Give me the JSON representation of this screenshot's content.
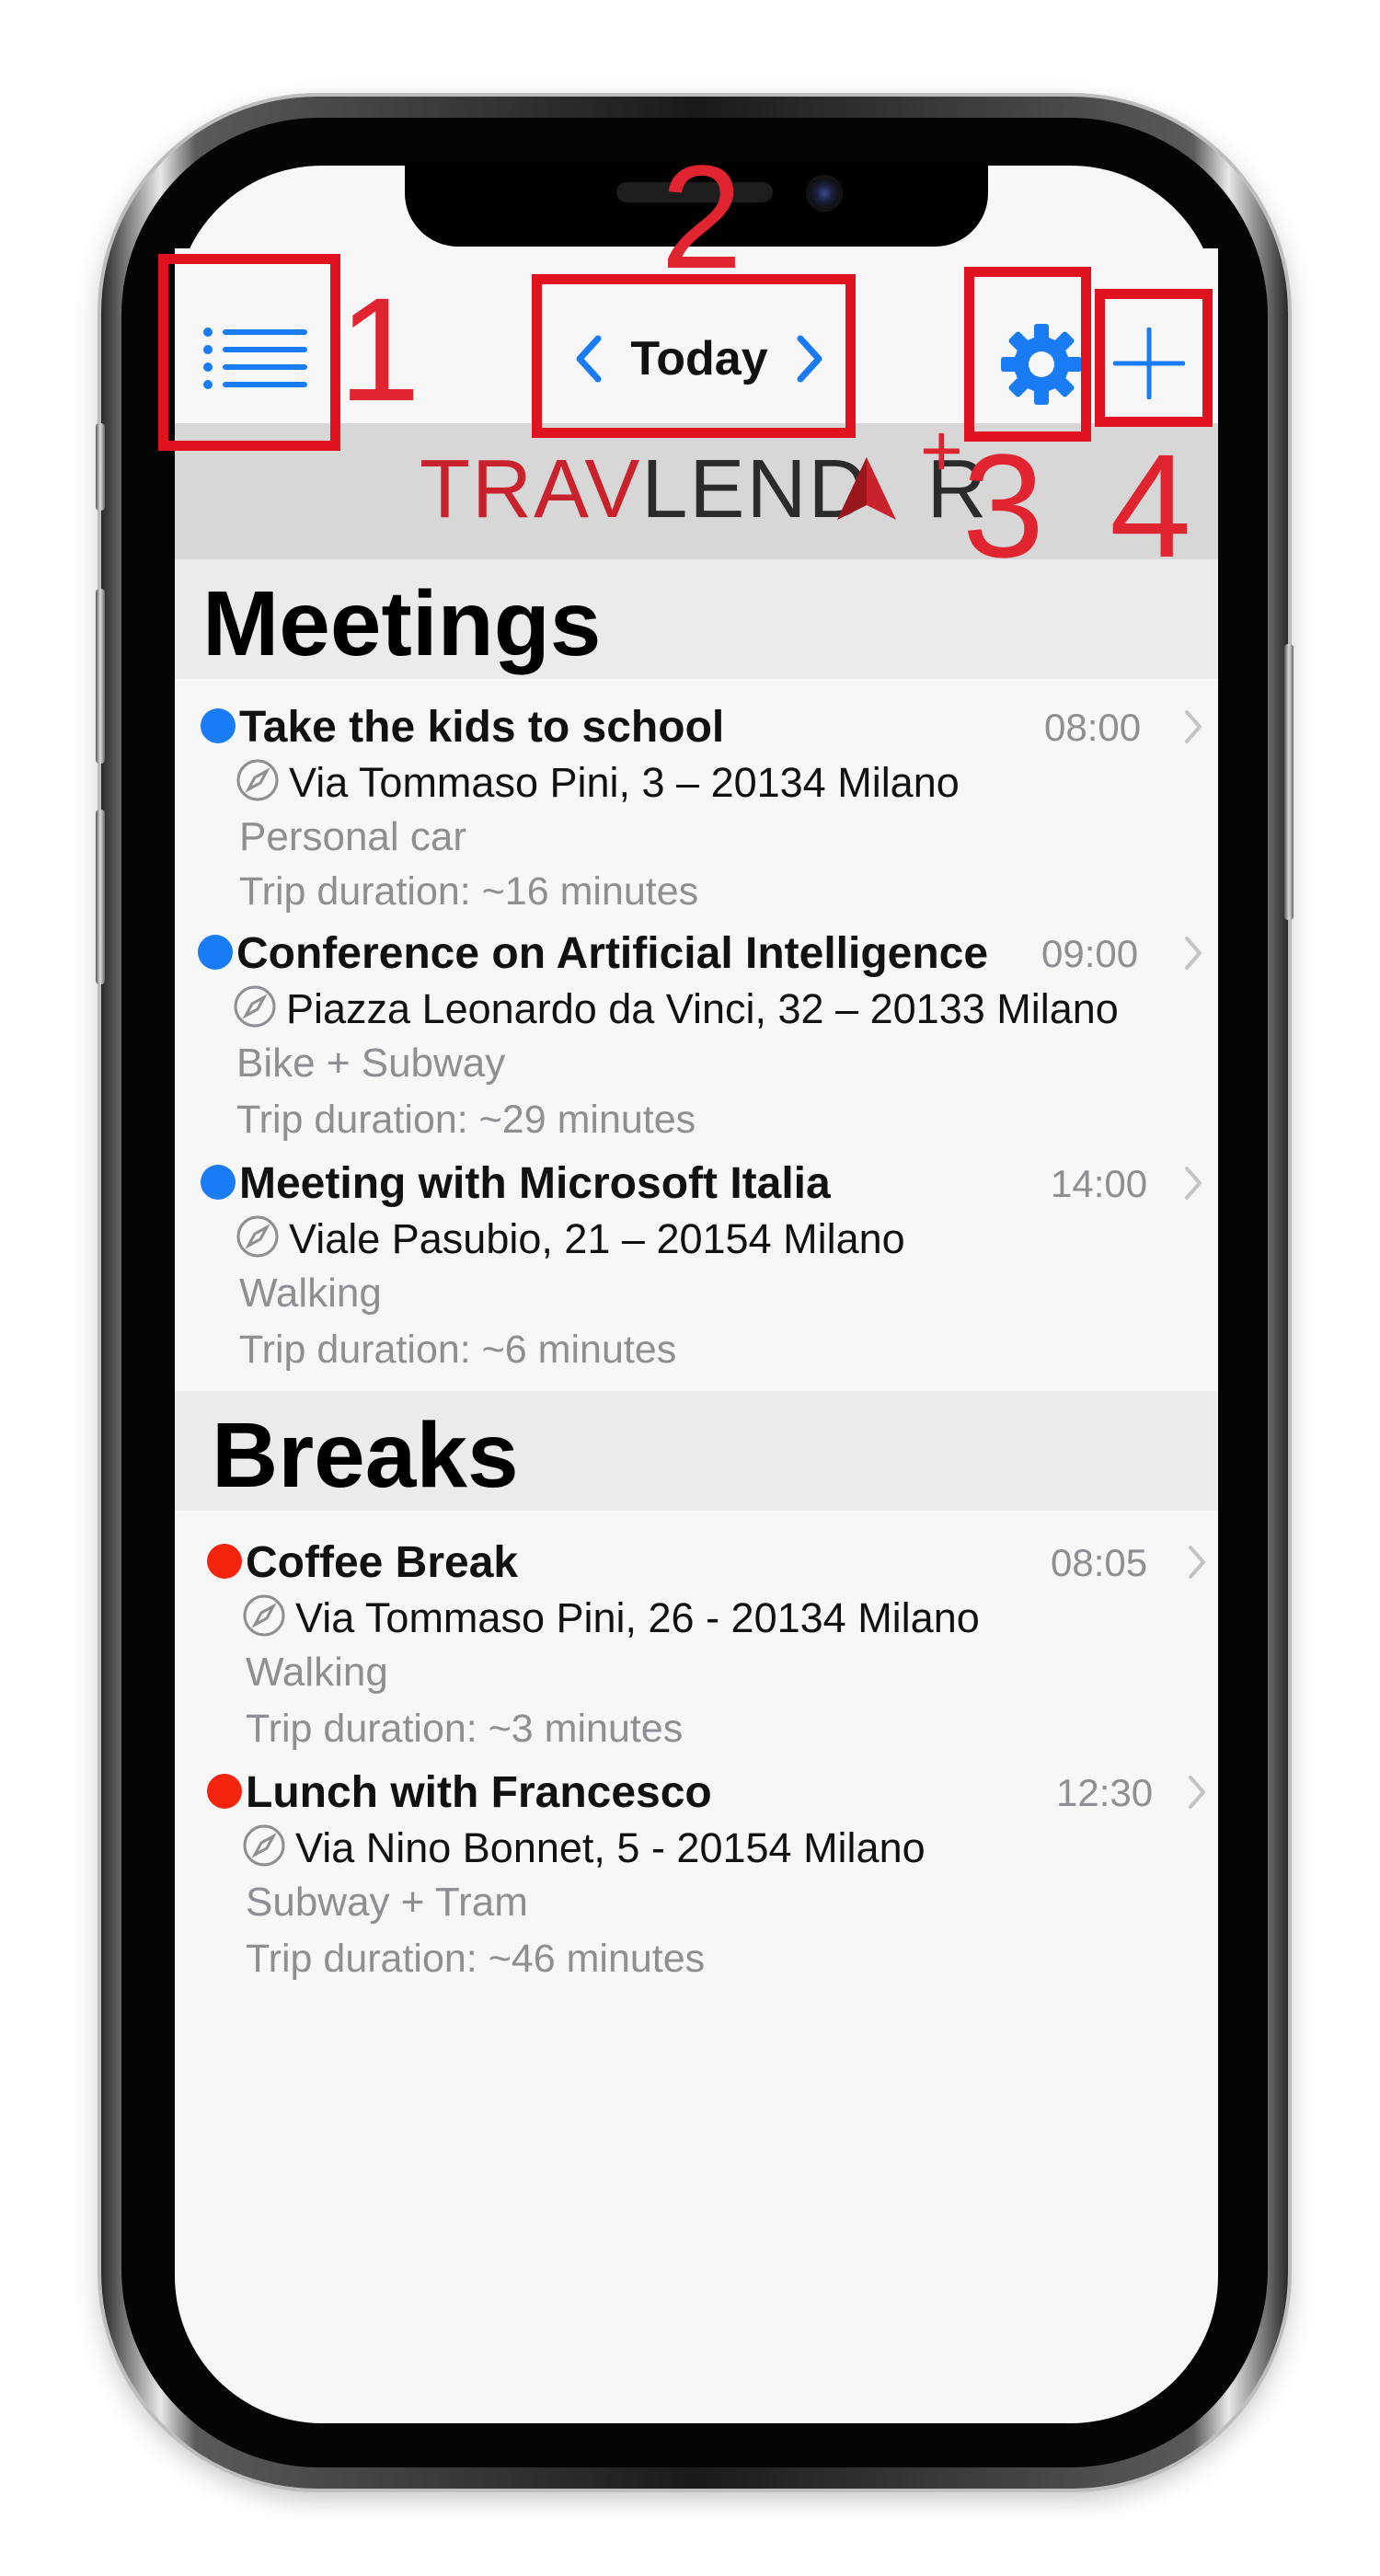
{
  "nav": {
    "date_label": "Today",
    "icons": {
      "menu": "list-icon",
      "prev": "chevron-left-icon",
      "next": "chevron-right-icon",
      "settings": "gear-icon",
      "add": "plus-icon"
    },
    "accent_color": "#1a7cf5"
  },
  "logo": {
    "text_red_1": "TRAV",
    "text_dark": "LEND",
    "text_red_2": "A",
    "text_dark_2": "R",
    "plus": "+"
  },
  "sections": [
    {
      "title": "Meetings",
      "dot_color": "#1a7cf5",
      "events": [
        {
          "title": "Take the kids to school",
          "time": "08:00",
          "address": "Via Tommaso Pini, 3 – 20134 Milano",
          "mode": "Personal car",
          "duration": "Trip duration: ~16 minutes"
        },
        {
          "title": "Conference on Artificial Intelligence",
          "time": "09:00",
          "address": "Piazza Leonardo da Vinci, 32 – 20133 Milano",
          "mode": "Bike + Subway",
          "duration": "Trip duration: ~29 minutes"
        },
        {
          "title": "Meeting with Microsoft Italia",
          "time": "14:00",
          "address": "Viale Pasubio, 21 – 20154 Milano",
          "mode": "Walking",
          "duration": "Trip duration: ~6 minutes"
        }
      ]
    },
    {
      "title": "Breaks",
      "dot_color": "#f5240f",
      "events": [
        {
          "title": "Coffee Break",
          "time": "08:05",
          "address": "Via Tommaso Pini, 26 - 20134 Milano",
          "mode": "Walking",
          "duration": "Trip duration: ~3 minutes"
        },
        {
          "title": "Lunch with Francesco",
          "time": "12:30",
          "address": "Via Nino Bonnet, 5 - 20154 Milano",
          "mode": "Subway + Tram",
          "duration": "Trip duration: ~46 minutes"
        }
      ]
    }
  ],
  "annotations": {
    "n1": "1",
    "n2": "2",
    "n3": "3",
    "n4": "4",
    "color": "#e0121f"
  }
}
